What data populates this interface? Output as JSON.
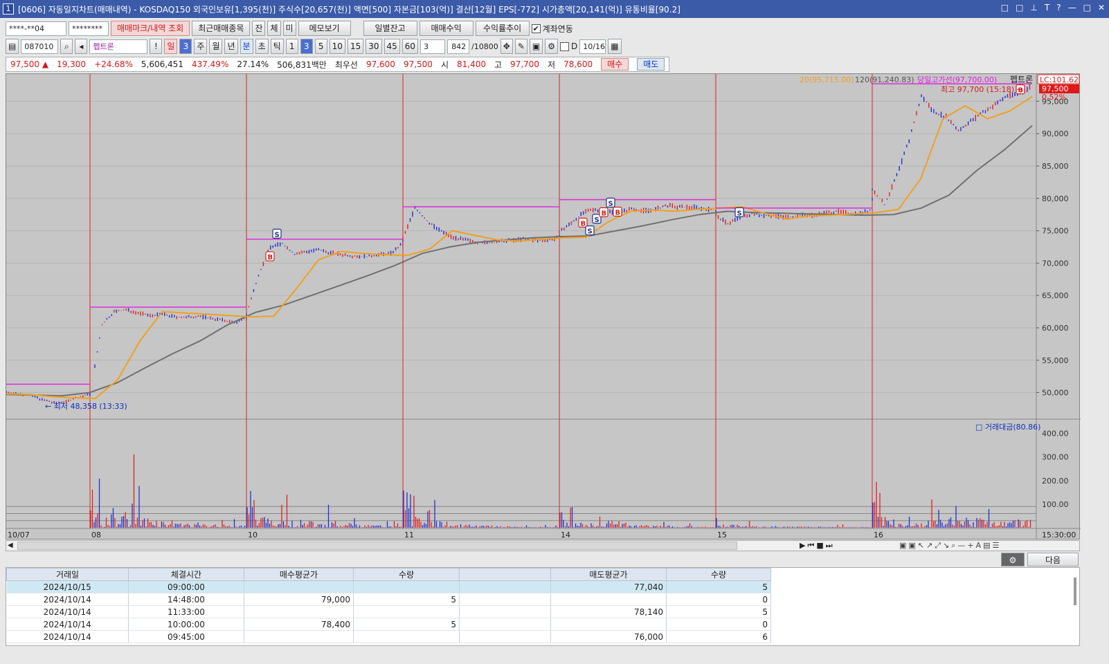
{
  "window": {
    "number": "1",
    "title": "[0606] 자동일지차트(매매내역) - KOSDAQ150 외국인보유[1,395(천)] 주식수[20,657(천)] 액면[500] 자본금[103(억)] 결산[12월] EPS[-772] 시가총액[20,141(억)] 유통비율[90.2]",
    "controls": [
      "□",
      "□",
      "⊥",
      "T",
      "?",
      "—",
      "□",
      "✕"
    ]
  },
  "toolbar1": {
    "account": "****-**04",
    "password": "********",
    "btn_mark": "매매마크/내역 조회",
    "btn_recent": "최근매매종목",
    "btn_jan": "잔",
    "btn_che": "체",
    "btn_mi": "미",
    "btn_memo": "메모보기",
    "btn_daily": "일별잔고",
    "btn_profit": "매매수익",
    "btn_rate": "수익률추이",
    "link_label": "계좌연동",
    "link_checked": "✔"
  },
  "toolbar2": {
    "code": "087010",
    "stock_name": "펩트론",
    "periods": [
      "일",
      "3",
      "주",
      "월",
      "년",
      "분",
      "초",
      "틱"
    ],
    "minutes": [
      "1",
      "3",
      "5",
      "10",
      "15",
      "30",
      "45",
      "60"
    ],
    "interval": "3",
    "count": "842",
    "count_max": "/10800",
    "d_label": "D",
    "date": "10/16"
  },
  "quote": {
    "price": "97,500",
    "arrow": "▲",
    "change": "19,300",
    "pct": "+24.68%",
    "volume": "5,606,451",
    "vol_ratio": "437.49%",
    "turnover": "27.14%",
    "amount": "506,831백만",
    "best_label": "최우선",
    "ask": "97,600",
    "bid": "97,500",
    "open_label": "시",
    "open": "81,400",
    "high_label": "고",
    "high": "97,700",
    "low_label": "저",
    "low": "78,600",
    "buy": "매수",
    "sell": "매도"
  },
  "chart_data": {
    "type": "line",
    "stock": "펩트론",
    "legend": [
      "20(95,715.00)",
      "120(91,240.83)",
      "당일고가선(97,700.00)"
    ],
    "lc_label": "LC:101.62",
    "last_price_tag": "97,500",
    "last_pct_tag": "0.52%",
    "high_annotation": "최고 97,700 (15:18)",
    "low_annotation": "최저 48,358 (13:33)",
    "y_ticks": [
      "95,000",
      "90,000",
      "85,000",
      "80,000",
      "75,000",
      "70,000",
      "65,000",
      "60,000",
      "55,000",
      "50,000"
    ],
    "ylim": [
      46000,
      99000
    ],
    "x_day_labels": [
      "10/07",
      "08",
      "10",
      "11",
      "14",
      "15",
      "16"
    ],
    "x_end_label": "15:30:00",
    "volume_label": "거래대금(80.86)",
    "volume_ticks": [
      "400.00",
      "300.00",
      "200.00",
      "100.00"
    ],
    "volume_ylim": [
      0,
      440
    ],
    "price_series": [
      {
        "day": "10/07",
        "values": [
          50100,
          49800,
          49600,
          48900,
          48400,
          48600,
          49300,
          49700
        ]
      },
      {
        "day": "10/08",
        "values": [
          49800,
          60500,
          62500,
          62800,
          62300,
          61900,
          62100,
          61700,
          61600,
          61800,
          61500,
          61200,
          60800,
          61500
        ]
      },
      {
        "day": "10/10",
        "values": [
          62000,
          68200,
          72500,
          73000,
          71400,
          71800,
          72000,
          71600,
          71300,
          71100,
          71000,
          71300,
          71500,
          73000
        ]
      },
      {
        "day": "10/11",
        "values": [
          73700,
          78600,
          76500,
          75100,
          74100,
          73600,
          73300,
          73100,
          73300,
          73500,
          73700,
          73500,
          73600,
          73900
        ]
      },
      {
        "day": "10/14",
        "values": [
          74800,
          76200,
          77800,
          78300,
          78000,
          77800,
          78400,
          78100,
          78300,
          78900,
          78600,
          78700,
          78400,
          78100
        ]
      },
      {
        "day": "10/15",
        "values": [
          77300,
          76100,
          77100,
          77600,
          77400,
          77300,
          77100,
          77400,
          77400,
          77700,
          78000,
          77700,
          77700,
          78200
        ]
      },
      {
        "day": "10/16",
        "values": [
          81400,
          79000,
          83500,
          89000,
          95800,
          93400,
          92600,
          90500,
          91900,
          93300,
          94500,
          95900,
          96200,
          97500
        ]
      }
    ],
    "ma20": [
      49800,
      49700,
      49400,
      49200,
      49100,
      52000,
      58000,
      62500,
      62300,
      62100,
      61900,
      61700,
      61800,
      66000,
      70500,
      71800,
      71500,
      71300,
      71200,
      72200,
      75000,
      74300,
      73600,
      73400,
      73700,
      73900,
      74000,
      76400,
      78000,
      78200,
      78000,
      78300,
      78500,
      78700,
      77700,
      76800,
      77300,
      77400,
      77600,
      77800,
      78300,
      83000,
      92300,
      94300,
      92300,
      93500,
      95715
    ],
    "ma120": [
      49700,
      49600,
      49500,
      50000,
      51500,
      53800,
      56000,
      58000,
      60500,
      62400,
      63500,
      65000,
      66500,
      68000,
      69600,
      71500,
      72500,
      73200,
      73600,
      73900,
      74100,
      74200,
      75000,
      75800,
      76700,
      77500,
      78000,
      77800,
      77700,
      77600,
      77500,
      77400,
      77500,
      78500,
      80500,
      84300,
      87500,
      91240
    ],
    "daily_high_line": [
      51300,
      63200,
      73700,
      78700,
      79800,
      78500,
      97700
    ],
    "trade_marks": [
      {
        "day": "10/10",
        "type": "B",
        "price": 71000
      },
      {
        "day": "10/10",
        "type": "S",
        "price": 74500
      },
      {
        "day": "10/14",
        "type": "B",
        "price": 76200
      },
      {
        "day": "10/14",
        "type": "S",
        "price": 75000
      },
      {
        "day": "10/14",
        "type": "S",
        "price": 76800
      },
      {
        "day": "10/14",
        "type": "B",
        "price": 77800
      },
      {
        "day": "10/14",
        "type": "S",
        "price": 79300
      },
      {
        "day": "10/14",
        "type": "B",
        "price": 77900
      },
      {
        "day": "10/15",
        "type": "S",
        "price": 77800
      },
      {
        "day": "10/16",
        "type": "B",
        "price": 96800
      }
    ],
    "volume_peaks": [
      {
        "day": "10/08",
        "values": [
          270,
          420,
          180,
          130,
          90,
          60,
          40
        ]
      },
      {
        "day": "10/10",
        "values": [
          190,
          150,
          140,
          120,
          80,
          50,
          30
        ]
      },
      {
        "day": "10/11",
        "values": [
          190,
          120,
          60,
          40,
          30,
          20,
          15
        ]
      },
      {
        "day": "10/14",
        "values": [
          90,
          80,
          120,
          50,
          40,
          30,
          20
        ]
      },
      {
        "day": "10/15",
        "values": [
          60,
          40,
          30,
          25,
          20,
          15,
          15
        ]
      },
      {
        "day": "10/16",
        "values": [
          200,
          80,
          150,
          180,
          170,
          120,
          160
        ]
      }
    ]
  },
  "table": {
    "next_btn": "다음",
    "headers": [
      "거래일",
      "체결시간",
      "매수평균가",
      "수량",
      "",
      "매도평균가",
      "수량"
    ],
    "rows": [
      [
        "2024/10/15",
        "09:00:00",
        "",
        "",
        "",
        "77,040",
        "5"
      ],
      [
        "2024/10/14",
        "14:48:00",
        "79,000",
        "5",
        "",
        "",
        "0"
      ],
      [
        "2024/10/14",
        "11:33:00",
        "",
        "",
        "",
        "78,140",
        "5"
      ],
      [
        "2024/10/14",
        "10:00:00",
        "78,400",
        "5",
        "",
        "",
        "0"
      ],
      [
        "2024/10/14",
        "09:45:00",
        "",
        "",
        "",
        "76,000",
        "6"
      ]
    ]
  },
  "colors": {
    "price_up": "#e02020",
    "price_down": "#2030d0",
    "ma20": "#f0a020",
    "ma120": "#707070",
    "high_line": "#e020e0",
    "day_sep": "#e02020"
  }
}
